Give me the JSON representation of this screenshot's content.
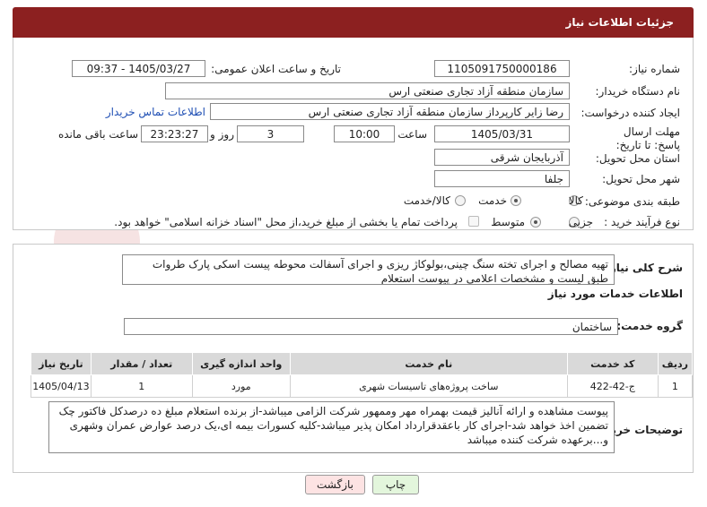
{
  "header": {
    "title": "جزئیات اطلاعات نیاز"
  },
  "fields": {
    "need_number_label": "شماره نیاز:",
    "need_number": "1105091750000186",
    "announce_label": "تاریخ و ساعت اعلان عمومی:",
    "announce_value": "1405/03/27 - 09:37",
    "buyer_org_label": "نام دستگاه خریدار:",
    "buyer_org": "سازمان منطقه آزاد تجاری صنعتی ارس",
    "creator_label": "ایجاد کننده درخواست:",
    "creator": "رضا زاير كارپرداز سازمان منطقه آزاد تجاری صنعتی ارس",
    "contact_link": "اطلاعات تماس خریدار",
    "deadline_label": "مهلت ارسال پاسخ: تا تاریخ:",
    "deadline_date": "1405/03/31",
    "time_label": "ساعت",
    "deadline_time": "10:00",
    "days_value": "3",
    "days_label": "روز و",
    "remaining_time": "23:23:27",
    "remaining_label": "ساعت باقی مانده",
    "province_label": "استان محل تحویل:",
    "province": "آذربایجان شرقی",
    "city_label": "شهر محل تحویل:",
    "city": "جلفا",
    "category_label": "طبقه بندی موضوعی:",
    "category_options": [
      "کالا",
      "خدمت",
      "کالا/خدمت"
    ],
    "category_selected": "خدمت",
    "purchase_label": "نوع فرآیند خرید :",
    "purchase_options": [
      "جزیی",
      "متوسط"
    ],
    "purchase_selected": "متوسط",
    "payment_note": "پرداخت تمام یا بخشی از مبلغ خرید،از محل \"اسناد خزانه اسلامی\" خواهد بود."
  },
  "summary": {
    "label": "شرح کلی نیاز:",
    "text": "تهیه مصالح و اجرای تخته سنگ چینی،بولوكاژ ريزی و اجرای آسفالت محوطه پیست اسکی پارک طروات طبق لیست و مشخصات اعلامی در پیوست استعلام"
  },
  "services": {
    "section_title": "اطلاعات خدمات مورد نیاز",
    "group_label": "گروه خدمت:",
    "group_value": "ساختمان",
    "columns": [
      "ردیف",
      "کد خدمت",
      "نام خدمت",
      "واحد اندازه گیری",
      "تعداد / مقدار",
      "تاریخ نیاز"
    ],
    "rows": [
      [
        "1",
        "ج-42-422",
        "ساخت پروژه‌های تاسیسات شهری",
        "مورد",
        "1",
        "1405/04/13"
      ]
    ]
  },
  "buyer_notes": {
    "label": "توضیحات خریدار:",
    "text": "پیوست مشاهده و ارائه آنالیز قیمت بهمراه مهر وممهور شرکت الزامی میباشد-از برنده استعلام مبلغ ده درصدکل فاکتور چک تضمین اخذ خواهد شد-اجرای کار باعقدقرارداد امکان پذیر میباشد-کلیه کسورات بیمه ای،یک درصد عوارض عمران وشهری و...برعهده شرکت کننده میباشد"
  },
  "buttons": {
    "print": "چاپ",
    "back": "بازگشت"
  },
  "watermark": "AriaTender.net",
  "colors": {
    "header_bg": "#8c2020",
    "link": "#1f4fb4",
    "back_btn_bg": "#fde3e3",
    "print_btn_bg": "#e3f6dc"
  }
}
